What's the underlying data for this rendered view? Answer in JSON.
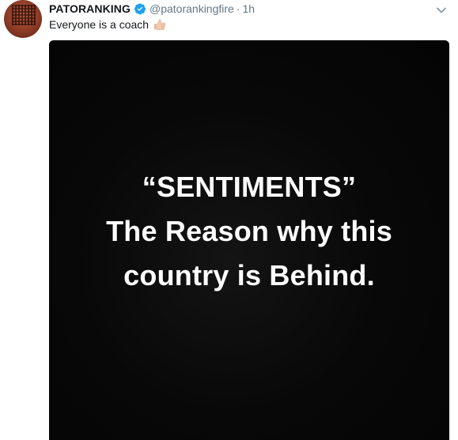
{
  "tweet": {
    "display_name": "PATORANKING",
    "handle": "@patorankingfire",
    "separator": "·",
    "time": "1h",
    "text": "Everyone is a coach",
    "verified": true,
    "icons": {
      "verified": "verified-badge-icon",
      "more": "chevron-down-icon",
      "emoji": "thumbs-up-icon"
    },
    "colors": {
      "name": "#14171a",
      "muted": "#657786",
      "verified": "#1da1f2",
      "media_background": "#060606",
      "media_text": "#ffffff"
    }
  },
  "media": {
    "line1": "“SENTIMENTS”",
    "line2": "The Reason why this",
    "line3": "country is Behind."
  }
}
